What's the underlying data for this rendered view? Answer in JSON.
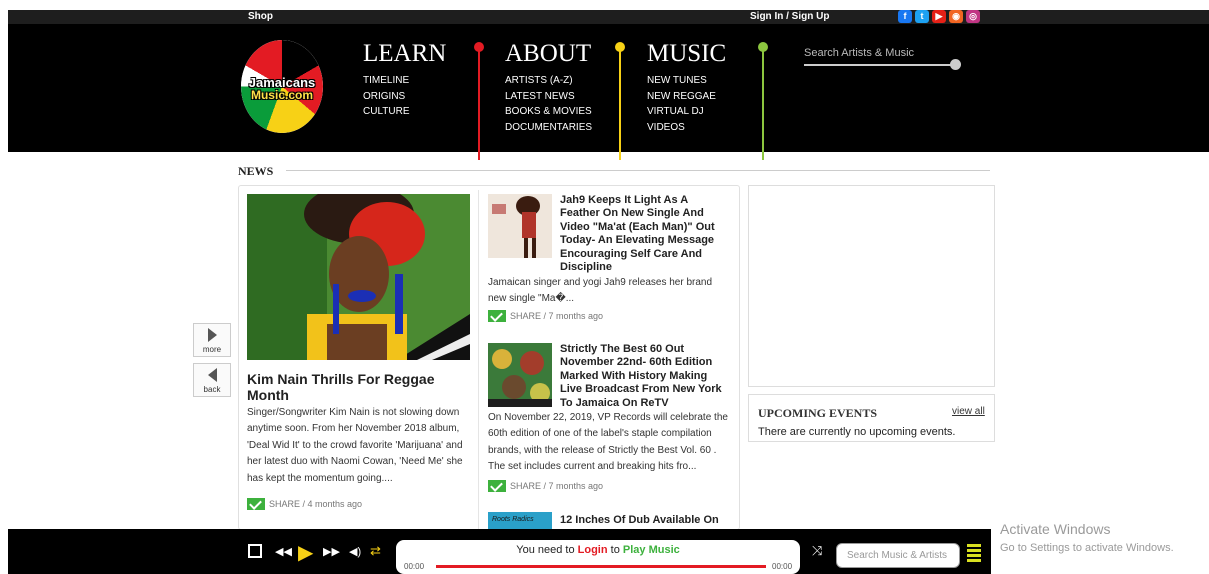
{
  "topbar": {
    "shop": "Shop",
    "sign": "Sign In / Sign Up"
  },
  "social": [
    {
      "name": "facebook-icon",
      "glyph": "f",
      "color": "#1877f2"
    },
    {
      "name": "twitter-icon",
      "glyph": "t",
      "color": "#1da1f2"
    },
    {
      "name": "youtube-icon",
      "glyph": "▶",
      "color": "#e62117"
    },
    {
      "name": "rss-icon",
      "glyph": "◉",
      "color": "#f26522"
    },
    {
      "name": "instagram-icon",
      "glyph": "◎",
      "color": "#c13584"
    }
  ],
  "logo": {
    "line1": "Jamaicans",
    "line2": "Music.com"
  },
  "nav": {
    "learn": {
      "title": "LEARN",
      "links": [
        "TIMELINE",
        "ORIGINS",
        "CULTURE"
      ]
    },
    "about": {
      "title": "ABOUT",
      "links": [
        "ARTISTS (A-Z)",
        "LATEST NEWS",
        "BOOKS & MOVIES",
        "DOCUMENTARIES"
      ]
    },
    "music": {
      "title": "MUSIC",
      "links": [
        "NEW TUNES",
        "NEW REGGAE",
        "VIRTUAL DJ",
        "VIDEOS"
      ]
    }
  },
  "search_top": {
    "placeholder": "Search Artists & Music"
  },
  "news": {
    "heading": "NEWS",
    "featured": {
      "title": "Kim Nain Thrills For Reggae Month",
      "body": "Singer/Songwriter Kim Nain is not slowing down anytime soon. From her November 2018 album, 'Deal Wid It' to the crowd favorite 'Marijuana' and her latest duo with Naomi Cowan, 'Need Me' she has kept the momentum going....",
      "share": "SHARE / 4 months ago"
    },
    "articles": [
      {
        "title": "Jah9 Keeps It Light As A Feather On New Single And Video \"Ma'at (Each Man)\" Out Today- An Elevating Message Encouraging Self Care And Discipline",
        "body": "Jamaican singer and yogi Jah9 releases her brand new single \"Ma�...",
        "share": "SHARE / 7 months ago"
      },
      {
        "title": "Strictly The Best 60 Out November 22nd- 60th Edition Marked With History Making Live Broadcast From New York To Jamaica On ReTV",
        "body": "On November 22, 2019, VP Records will celebrate the 60th edition of one of the label's staple compilation brands, with the release of Strictly the Best Vol. 60 . The set includes current and breaking hits fro...",
        "share": "SHARE / 7 months ago"
      },
      {
        "title": "12 Inches Of Dub Available On",
        "thumb_text": "Roots Radics"
      }
    ]
  },
  "side_nav": {
    "more": "more",
    "back": "back"
  },
  "events": {
    "title": "UPCOMING EVENTS",
    "view_all": "view all",
    "message": "There are currently no upcoming events."
  },
  "player": {
    "msg_prefix": "You need to",
    "login": "Login",
    "msg_mid": "to",
    "play": "Play Music",
    "time_start": "00:00",
    "time_end": "00:00",
    "search_placeholder": "Search Music & Artists"
  },
  "windows": {
    "line1": "Activate Windows",
    "line2": "Go to Settings to activate Windows."
  }
}
